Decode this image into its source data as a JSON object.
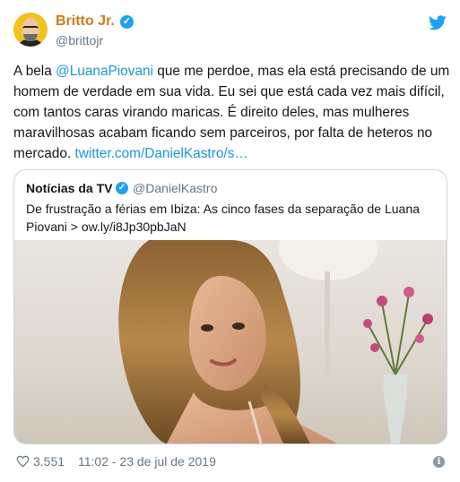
{
  "author": {
    "name": "Britto Jr.",
    "handle": "@brittojr"
  },
  "tweet": {
    "text_before": "A bela ",
    "mention": "@LuanaPiovani",
    "text_after": " que me perdoe, mas ela está precisando de um homem de verdade em sua vida. Eu sei que está cada vez mais difícil, com tantos caras virando maricas. É direito deles, mas mulheres maravilhosas acabam ficando sem parceiros, por falta de heteros no mercado. ",
    "link": "twitter.com/DanielKastro/s…"
  },
  "quoted": {
    "name": "Notícias da TV",
    "handle": "@DanielKastro",
    "text": "De frustração a férias em Ibiza: As cinco fases da separação de Luana Piovani > ow.ly/i8Jp30pbJaN"
  },
  "footer": {
    "likes": "3.551",
    "timestamp": "11:02 - 23 de jul de 2019"
  },
  "icons": {
    "verified": "check",
    "twitter": "bird",
    "like": "heart-outline",
    "info": "info"
  },
  "colors": {
    "accent": "#1da1f2",
    "link": "#1b95e0",
    "name": "#d47a1c",
    "muted": "#657786"
  }
}
